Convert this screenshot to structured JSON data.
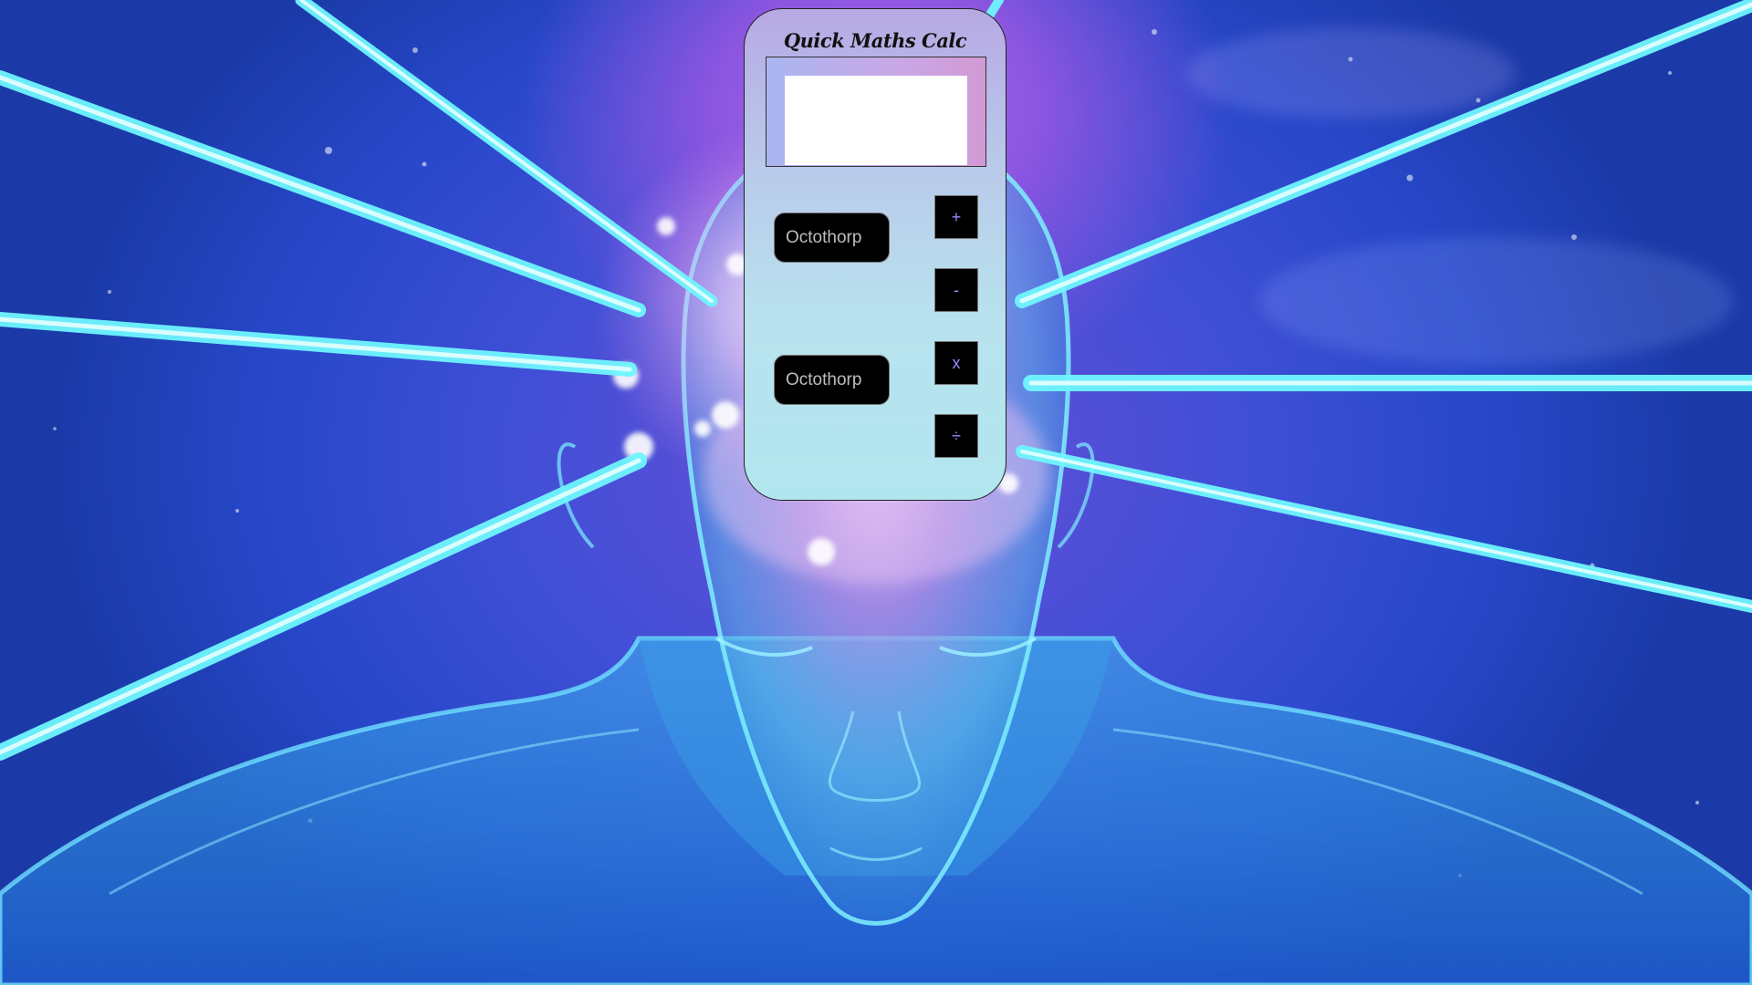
{
  "calculator": {
    "title": "Quick Maths Calc",
    "display_value": "",
    "input_a": {
      "value": "",
      "placeholder": "Octothorp"
    },
    "input_b": {
      "value": "",
      "placeholder": "Octothorp"
    },
    "operators": {
      "add": "+",
      "subtract": "-",
      "multiply": "x",
      "divide": "÷"
    }
  },
  "background": {
    "description_icon": "glowing-head-icon",
    "colors": {
      "space_blue": "#2747c9",
      "nebula_purple": "#8a55e0",
      "laser_cyan": "#5ff3ff",
      "head_glow": "#7fe0ff"
    }
  }
}
